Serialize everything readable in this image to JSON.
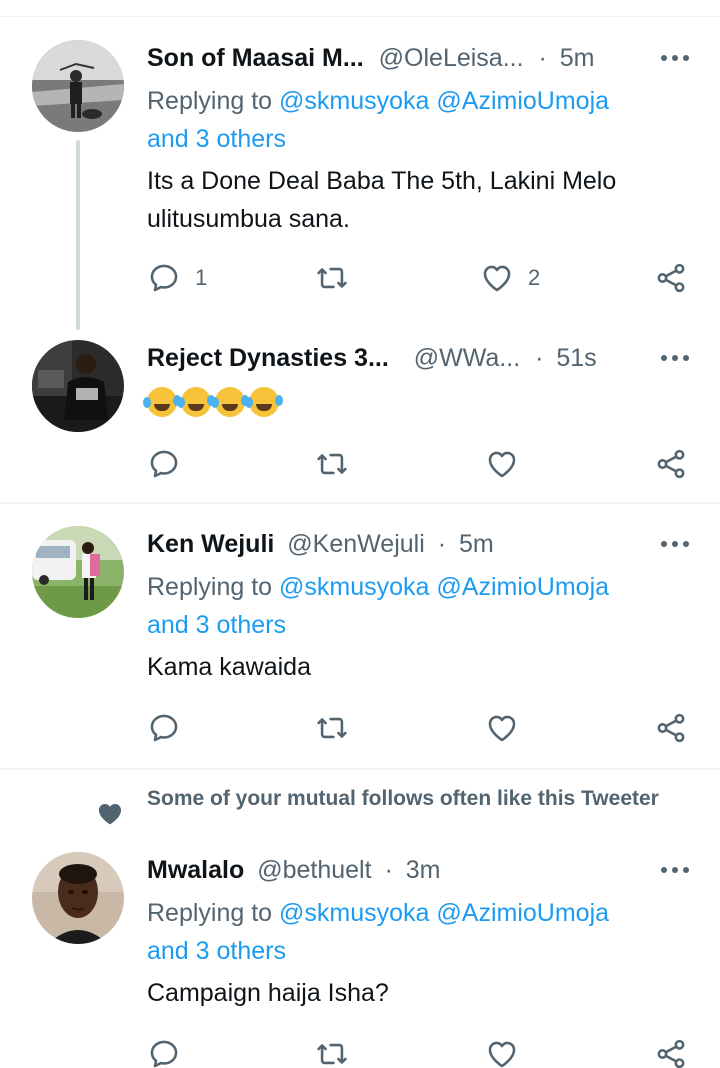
{
  "tweets": [
    {
      "name": "Son of Maasai M...",
      "handle": "@OleLeisa...",
      "separator": "·",
      "time": "5m",
      "replying_prefix": "Replying to",
      "replying_users": "@skmusyoka @AzimioUmoja",
      "replying_others": "and 3 others",
      "text": "Its a Done Deal Baba The 5th, Lakini Melo ulitusumbua sana.",
      "reply_count": "1",
      "retweet_count": "",
      "like_count": "2"
    },
    {
      "name": "Reject Dynasties 3...",
      "handle": "@WWa...",
      "separator": "·",
      "time": "51s",
      "text": "🤣🤣🤣🤣",
      "reply_count": "",
      "retweet_count": "",
      "like_count": ""
    },
    {
      "name": "Ken Wejuli",
      "handle": "@KenWejuli",
      "separator": "·",
      "time": "5m",
      "replying_prefix": "Replying to",
      "replying_users": "@skmusyoka @AzimioUmoja",
      "replying_others": "and 3 others",
      "text": "Kama kawaida",
      "reply_count": "",
      "retweet_count": "",
      "like_count": ""
    },
    {
      "social_context": "Some of your mutual follows often like this Tweeter",
      "name": "Mwalalo",
      "handle": "@bethuelt",
      "separator": "·",
      "time": "3m",
      "replying_prefix": "Replying to",
      "replying_users": "@skmusyoka @AzimioUmoja",
      "replying_others": "and 3 others",
      "text": "Campaign haija Isha?",
      "reply_count": "",
      "retweet_count": "",
      "like_count": ""
    }
  ],
  "icons": {
    "reply": "reply-icon",
    "retweet": "retweet-icon",
    "like": "heart-icon",
    "share": "share-icon",
    "more": "more-icon"
  },
  "colors": {
    "link": "#1d9bf0",
    "secondary_text": "#536471",
    "divider": "#eff3f4",
    "thread_line": "#cfd9de"
  }
}
